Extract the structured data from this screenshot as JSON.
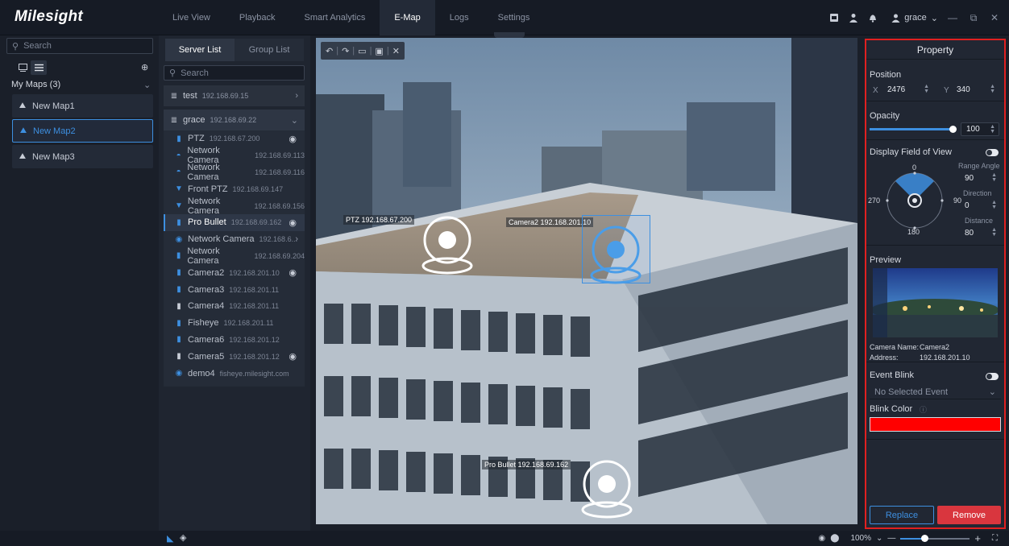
{
  "app": {
    "logo": "Milesight"
  },
  "nav": {
    "items": [
      "Live View",
      "Playback",
      "Smart Analytics",
      "E-Map",
      "Logs",
      "Settings"
    ],
    "active": "E-Map"
  },
  "user": {
    "name": "grace"
  },
  "left": {
    "search_placeholder": "Search",
    "maps_title": "My Maps (3)",
    "maps": [
      "New Map1",
      "New Map2",
      "New Map3"
    ],
    "active_map": "New Map2"
  },
  "server": {
    "tabs": [
      "Server List",
      "Group List"
    ],
    "search_placeholder": "Search",
    "servers": [
      {
        "name": "test",
        "ip": "192.168.69.15"
      },
      {
        "name": "grace",
        "ip": "192.168.69.22"
      }
    ],
    "devices": [
      {
        "name": "PTZ",
        "ip": "192.168.67.200",
        "placed": true
      },
      {
        "name": "Network Camera",
        "ip": "192.168.69.113",
        "placed": false
      },
      {
        "name": "Network Camera",
        "ip": "192.168.69.116",
        "placed": false
      },
      {
        "name": "Front PTZ",
        "ip": "192.168.69.147",
        "placed": false
      },
      {
        "name": "Network Camera",
        "ip": "192.168.69.156",
        "placed": false
      },
      {
        "name": "Pro Bullet",
        "ip": "192.168.69.162",
        "placed": true
      },
      {
        "name": "Network Camera",
        "ip": "192.168.6...",
        "placed": false
      },
      {
        "name": "Network Camera",
        "ip": "192.168.69.204",
        "placed": false
      },
      {
        "name": "Camera2",
        "ip": "192.168.201.10",
        "placed": true
      },
      {
        "name": "Camera3",
        "ip": "192.168.201.11",
        "placed": false
      },
      {
        "name": "Camera4",
        "ip": "192.168.201.11",
        "placed": false
      },
      {
        "name": "Fisheye",
        "ip": "192.168.201.11",
        "placed": false
      },
      {
        "name": "Camera6",
        "ip": "192.168.201.12",
        "placed": false
      },
      {
        "name": "Camera5",
        "ip": "192.168.201.12",
        "placed": true
      },
      {
        "name": "demo4",
        "ip": "fisheye.milesight.com",
        "placed": false
      }
    ]
  },
  "map_labels": {
    "ptz": "PTZ 192.168.67.200",
    "cam2": "Camera2 192.168.201.10",
    "bullet": "Pro Bullet 192.168.69.162"
  },
  "property": {
    "title": "Property",
    "position_label": "Position",
    "x_label": "X",
    "x": "2476",
    "y_label": "Y",
    "y": "340",
    "opacity_label": "Opacity",
    "opacity": "100",
    "opacity_fraction": 1.0,
    "fov_label": "Display Field of View",
    "dir_0": "0",
    "dir_90": "90",
    "dir_180": "180",
    "dir_270": "270",
    "range_angle_label": "Range Angle",
    "range_angle": "90",
    "direction_label": "Direction",
    "direction": "0",
    "distance_label": "Distance",
    "distance": "80",
    "preview_label": "Preview",
    "camera_name_label": "Camera Name:",
    "camera_name": "Camera2",
    "address_label": "Address:",
    "address": "192.168.201.10",
    "event_blink_label": "Event Blink",
    "event_select": "No Selected Event",
    "blink_color_label": "Blink Color",
    "blink_color": "#ff0000",
    "replace": "Replace",
    "remove": "Remove"
  },
  "bottom": {
    "zoom": "100%",
    "zoom_fraction": 0.34
  }
}
